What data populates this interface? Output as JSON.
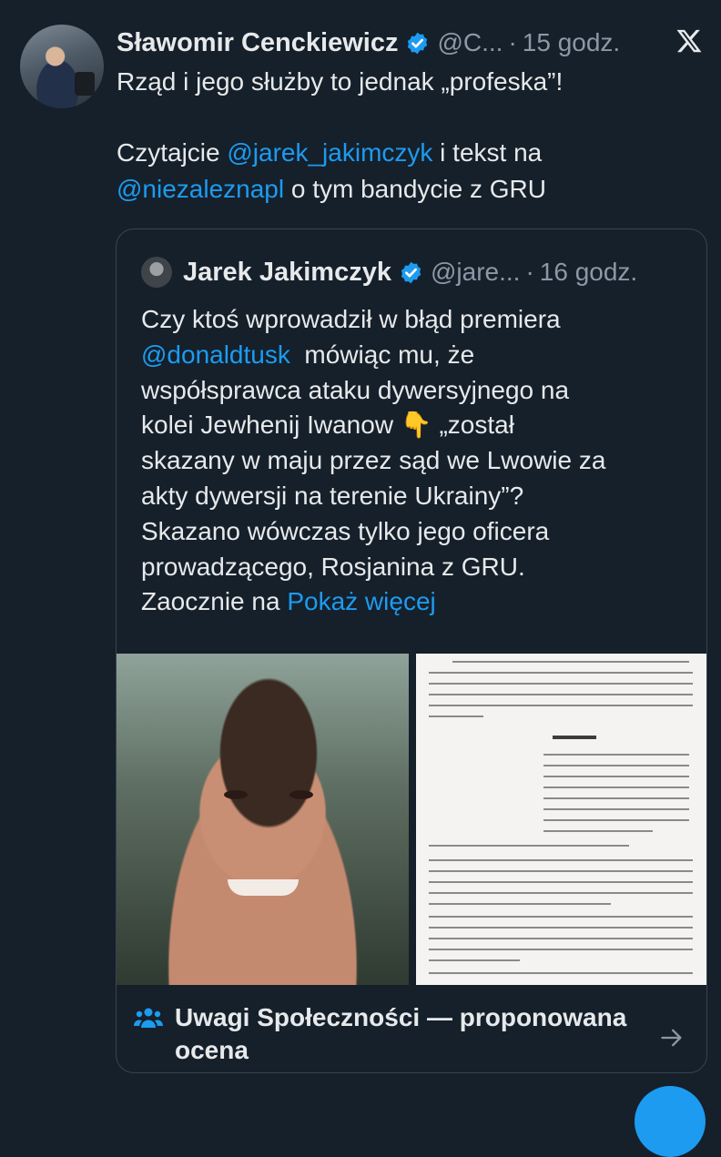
{
  "tweet": {
    "author_name": "Sławomir Cenckiewicz",
    "handle": "@C...",
    "separator": "·",
    "time": "15 godz.",
    "line1": "Rząd i jego służby to jednak „profeska”!",
    "line2_prefix": "Czytajcie ",
    "mention1": "@jarek_jakimczyk",
    "line2_suffix": " i tekst na",
    "mention2": "@niezaleznapl",
    "line3_suffix": " o tym bandycie z GRU"
  },
  "quote": {
    "author_name": "Jarek Jakimczyk",
    "handle": "@jare...",
    "separator": "·",
    "time": "16 godz.",
    "lines": {
      "l1": "Czy ktoś wprowadził w błąd premiera",
      "mention": "@donaldtusk",
      "l2_suffix": "  mówiąc mu, że",
      "l3": "współsprawca ataku dywersyjnego na",
      "l4_prefix": "kolei Jewhenij Iwanow ",
      "emoji": "👇",
      "l4_suffix": " „został",
      "l5": "skazany w maju przez sąd we Lwowie za",
      "l6": "akty dywersji na terenie Ukrainy”?",
      "l7": "Skazano wówczas tylko jego oficera",
      "l8": "prowadzącego, Rosjanina z GRU.",
      "l9_prefix": "Zaocznie na ",
      "show_more": "Pokaż więcej"
    }
  },
  "community_note": {
    "line1": "Uwagi Społeczności — proponowana",
    "line2": "ocena"
  },
  "icons": {
    "verified": "verified-badge-icon",
    "x_logo": "x-logo-icon",
    "people": "people-icon",
    "arrow": "arrow-right-icon"
  },
  "colors": {
    "background": "#15202b",
    "text": "#e7e9ea",
    "muted": "#8b98a5",
    "link": "#1d9bf0",
    "border": "#38444d"
  }
}
